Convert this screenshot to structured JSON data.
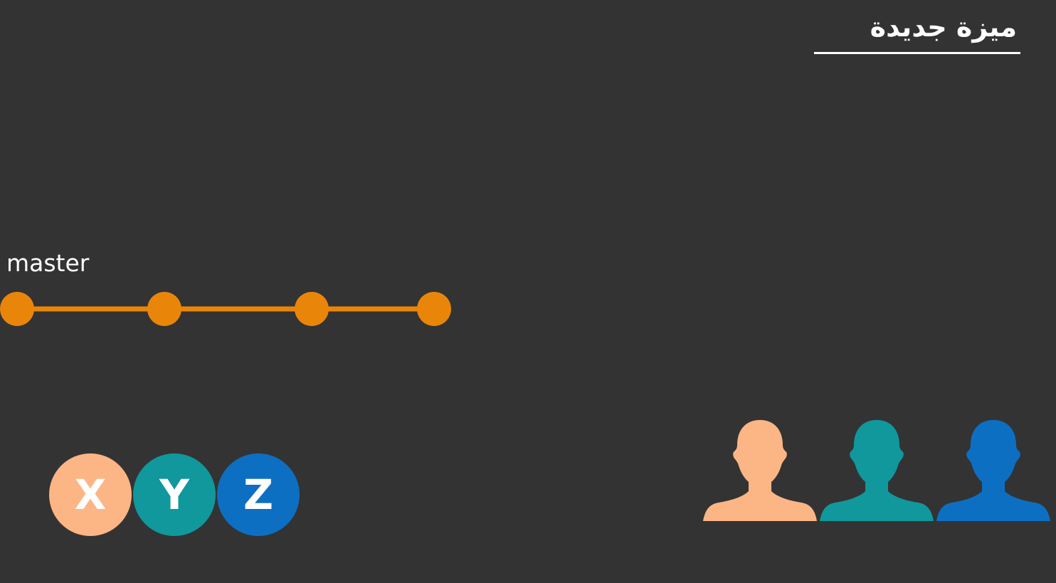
{
  "title": "ميزة جديدة",
  "branch": {
    "label": "master",
    "commit_count": 4,
    "color": "#e9860a"
  },
  "badges": [
    {
      "letter": "X",
      "color": "#fcb584"
    },
    {
      "letter": "Y",
      "color": "#10989c"
    },
    {
      "letter": "Z",
      "color": "#0d6fc2"
    }
  ],
  "people": [
    {
      "icon": "person-silhouette-icon",
      "color": "#fcb584"
    },
    {
      "icon": "person-silhouette-icon",
      "color": "#10989c"
    },
    {
      "icon": "person-silhouette-icon",
      "color": "#0d6fc2"
    }
  ],
  "colors": {
    "background": "#333333",
    "text": "#ffffff"
  }
}
